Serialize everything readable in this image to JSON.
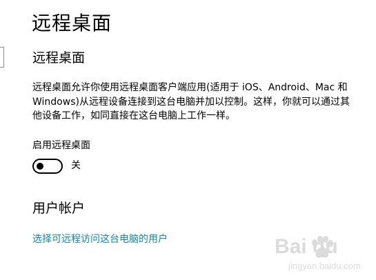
{
  "page": {
    "title": "远程桌面"
  },
  "remote_desktop": {
    "section_title": "远程桌面",
    "description": "远程桌面允许你使用远程桌面客户端应用(适用于 iOS、Android、Mac 和 Windows)从远程设备连接到这台电脑并加以控制。这样，你就可以通过其他设备工作，如同直接在这台电脑上工作一样。",
    "toggle_label": "启用远程桌面",
    "toggle_state": "关",
    "toggle_on": false
  },
  "user_accounts": {
    "section_title": "用户帐户",
    "link_text": "选择可远程访问这台电脑的用户"
  },
  "watermark": {
    "brand": "Bai  du",
    "sub": "jingyan.baidu.com",
    "icon": "baidu-paw-icon"
  },
  "colors": {
    "link": "#0f8aa5",
    "text": "#000000",
    "background": "#ffffff"
  }
}
